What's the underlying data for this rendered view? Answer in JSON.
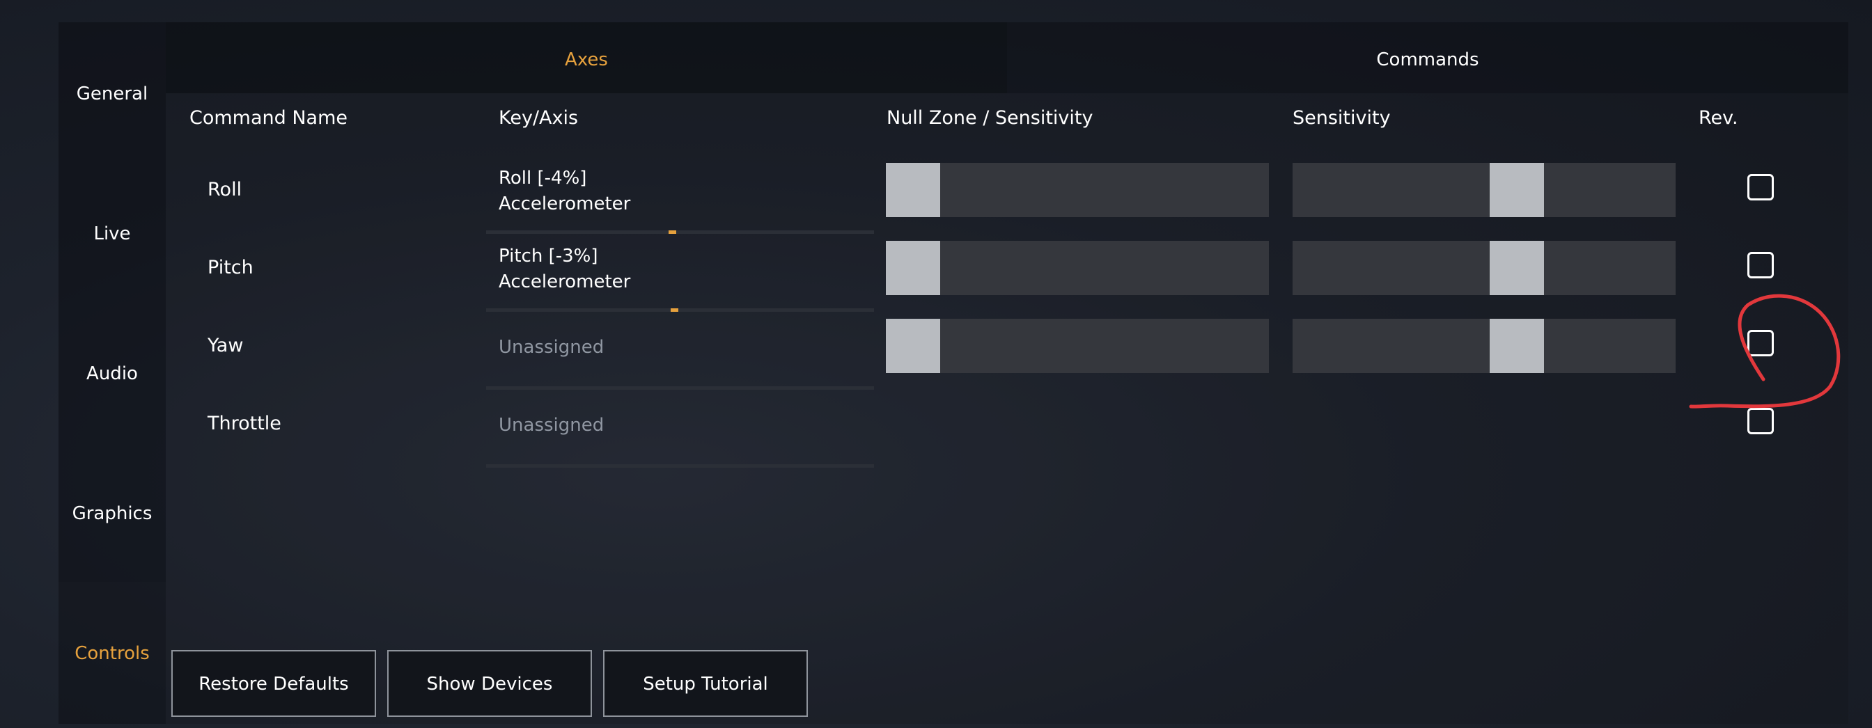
{
  "sidebar": {
    "items": [
      {
        "label": "General"
      },
      {
        "label": "Live"
      },
      {
        "label": "Audio"
      },
      {
        "label": "Graphics"
      },
      {
        "label": "Controls"
      }
    ],
    "active": "Controls"
  },
  "tabs": [
    {
      "label": "Axes",
      "active": true
    },
    {
      "label": "Commands",
      "active": false
    }
  ],
  "table": {
    "headers": {
      "command_name": "Command Name",
      "key_axis": "Key/Axis",
      "null_zone": "Null Zone / Sensitivity",
      "sensitivity": "Sensitivity",
      "rev": "Rev."
    },
    "rows": [
      {
        "command": "Roll",
        "key_line1": "Roll [-4%]",
        "key_line2": "Accelerometer",
        "axis_value_percent": -4,
        "null_zone_fraction": 0.0,
        "sensitivity_fraction": 0.6,
        "reversed": false
      },
      {
        "command": "Pitch",
        "key_line1": "Pitch [-3%]",
        "key_line2": "Accelerometer",
        "axis_value_percent": -3,
        "null_zone_fraction": 0.0,
        "sensitivity_fraction": 0.6,
        "reversed": false
      },
      {
        "command": "Yaw",
        "key_line1": "Unassigned",
        "key_line2": "",
        "null_zone_fraction": 0.0,
        "sensitivity_fraction": 0.6,
        "reversed": false
      },
      {
        "command": "Throttle",
        "key_line1": "Unassigned",
        "key_line2": "",
        "reversed": false
      }
    ]
  },
  "buttons": {
    "restore_defaults": "Restore Defaults",
    "show_devices": "Show Devices",
    "setup_tutorial": "Setup Tutorial"
  },
  "colors": {
    "accent": "#e6a13d",
    "annotation": "#e2383c"
  }
}
